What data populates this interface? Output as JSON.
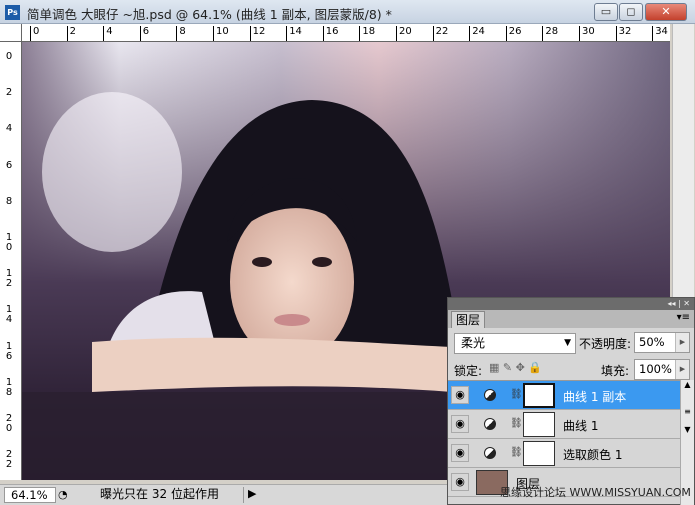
{
  "window": {
    "title": "简单调色 大眼仔 ~旭.psd @ 64.1% (曲线 1 副本, 图层蒙版/8) *",
    "app_icon": "Ps",
    "minimize": "▭",
    "maximize": "◻",
    "close": "✕"
  },
  "ruler_h": [
    "0",
    "2",
    "4",
    "6",
    "8",
    "10",
    "12",
    "14",
    "16",
    "18",
    "20",
    "22",
    "24",
    "26",
    "28",
    "30",
    "32",
    "34"
  ],
  "ruler_v": [
    "0",
    "2",
    "4",
    "6",
    "8",
    "10",
    "12",
    "14",
    "16",
    "18",
    "20",
    "22"
  ],
  "status": {
    "zoom": "64.1%",
    "message": "曝光只在 32 位起作用"
  },
  "layers_panel": {
    "tab": "图层",
    "blend_mode": "柔光",
    "opacity_label": "不透明度:",
    "opacity": "50%",
    "lock_label": "锁定:",
    "fill_label": "填充:",
    "fill": "100%",
    "layers": [
      {
        "name": "曲线 1 副本",
        "selected": true
      },
      {
        "name": "曲线 1",
        "selected": false
      },
      {
        "name": "选取颜色 1",
        "selected": false
      },
      {
        "name": "图层",
        "selected": false
      }
    ],
    "watermark": "思缘设计论坛 WWW.MISSYUAN.COM"
  },
  "colors": {
    "selection": "#3b99f0"
  }
}
